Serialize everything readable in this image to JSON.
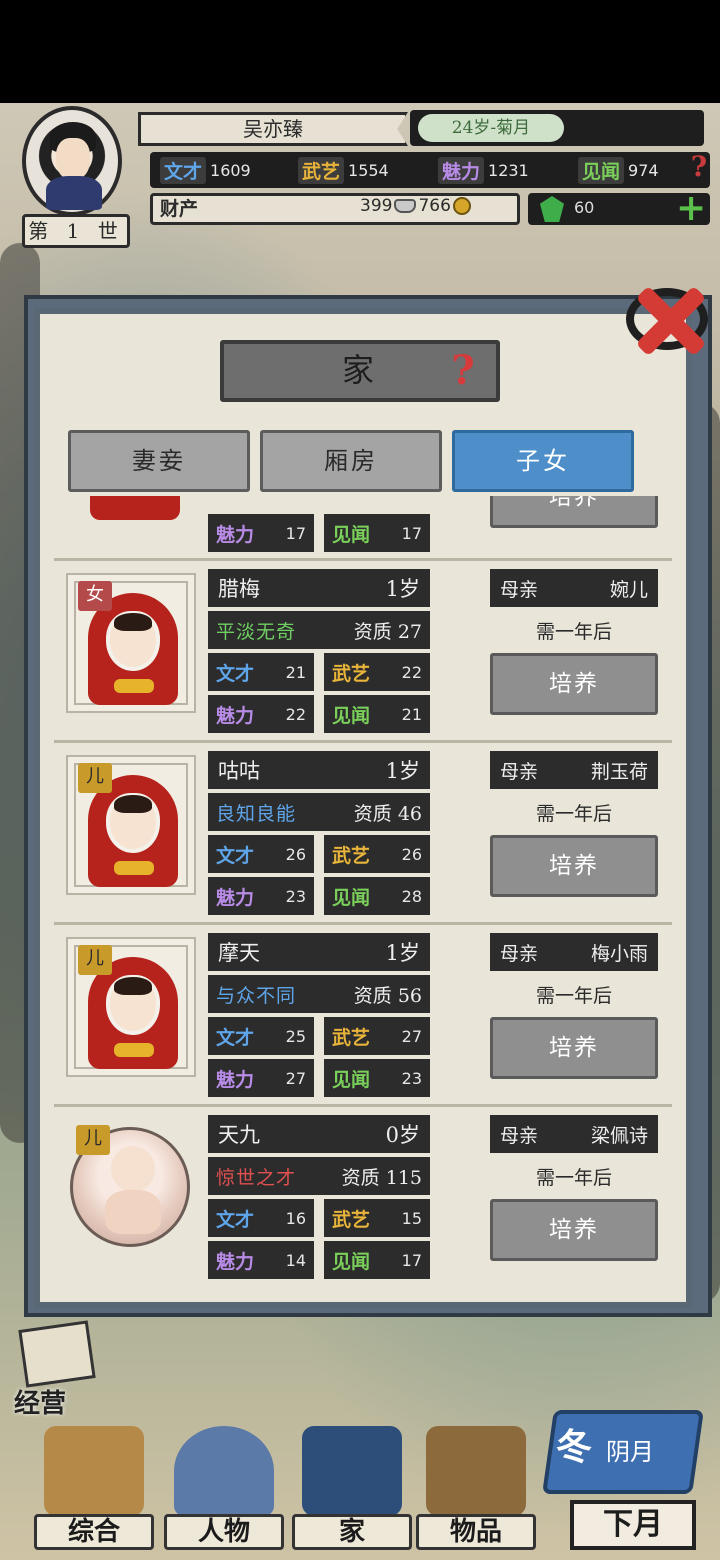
{
  "player": {
    "name": "吴亦臻",
    "age_month": "24岁-菊月",
    "generation": "第 1 世",
    "stats": [
      {
        "label": "文才",
        "value": "1609",
        "color": "#5fa5ea"
      },
      {
        "label": "武艺",
        "value": "1554",
        "color": "#e9b43a"
      },
      {
        "label": "魅力",
        "value": "1231",
        "color": "#b88be6"
      },
      {
        "label": "见闻",
        "value": "974",
        "color": "#7ad05a"
      }
    ],
    "help_icon": "?",
    "assets_label": "财产",
    "silver": "399",
    "copper": "766",
    "jade": "60",
    "plus_icon": "+"
  },
  "modal": {
    "title": "家",
    "help_icon": "?",
    "tabs": [
      {
        "label": "妻妾",
        "active": false
      },
      {
        "label": "厢房",
        "active": false
      },
      {
        "label": "子女",
        "active": true
      }
    ]
  },
  "partial_row": {
    "stats": [
      {
        "label": "魅力",
        "value": "17"
      },
      {
        "label": "见闻",
        "value": "17"
      }
    ],
    "button_label": "培养"
  },
  "children": [
    {
      "gender": "女",
      "name": "腊梅",
      "age": "1岁",
      "talent": "平淡无奇",
      "talent_color": "#6fcf62",
      "aptitude_label": "资质",
      "aptitude": "27",
      "stats": [
        {
          "label": "文才",
          "value": "21"
        },
        {
          "label": "武艺",
          "value": "22"
        },
        {
          "label": "魅力",
          "value": "22"
        },
        {
          "label": "见闻",
          "value": "21"
        }
      ],
      "mother_label": "母亲",
      "mother": "婉儿",
      "wait": "需一年后",
      "button": "培养"
    },
    {
      "gender": "儿",
      "name": "咕咕",
      "age": "1岁",
      "talent": "良知良能",
      "talent_color": "#5fa5ea",
      "aptitude_label": "资质",
      "aptitude": "46",
      "stats": [
        {
          "label": "文才",
          "value": "26"
        },
        {
          "label": "武艺",
          "value": "26"
        },
        {
          "label": "魅力",
          "value": "23"
        },
        {
          "label": "见闻",
          "value": "28"
        }
      ],
      "mother_label": "母亲",
      "mother": "荆玉荷",
      "wait": "需一年后",
      "button": "培养"
    },
    {
      "gender": "儿",
      "name": "摩天",
      "age": "1岁",
      "talent": "与众不同",
      "talent_color": "#5fa5ea",
      "aptitude_label": "资质",
      "aptitude": "56",
      "stats": [
        {
          "label": "文才",
          "value": "25"
        },
        {
          "label": "武艺",
          "value": "27"
        },
        {
          "label": "魅力",
          "value": "27"
        },
        {
          "label": "见闻",
          "value": "23"
        }
      ],
      "mother_label": "母亲",
      "mother": "梅小雨",
      "wait": "需一年后",
      "button": "培养"
    },
    {
      "gender": "儿",
      "name": "天九",
      "age": "0岁",
      "talent": "惊世之才",
      "talent_color": "#e05050",
      "aptitude_label": "资质",
      "aptitude": "115",
      "stats": [
        {
          "label": "文才",
          "value": "16"
        },
        {
          "label": "武艺",
          "value": "15"
        },
        {
          "label": "魅力",
          "value": "14"
        },
        {
          "label": "见闻",
          "value": "17"
        }
      ],
      "mother_label": "母亲",
      "mother": "梁佩诗",
      "wait": "需一年后",
      "button": "培养"
    }
  ],
  "bottom_nav": {
    "camp": "经营",
    "items": [
      "综合",
      "人物",
      "家",
      "物品"
    ],
    "season_char": "冬",
    "month": "阴月",
    "next": "下月"
  }
}
